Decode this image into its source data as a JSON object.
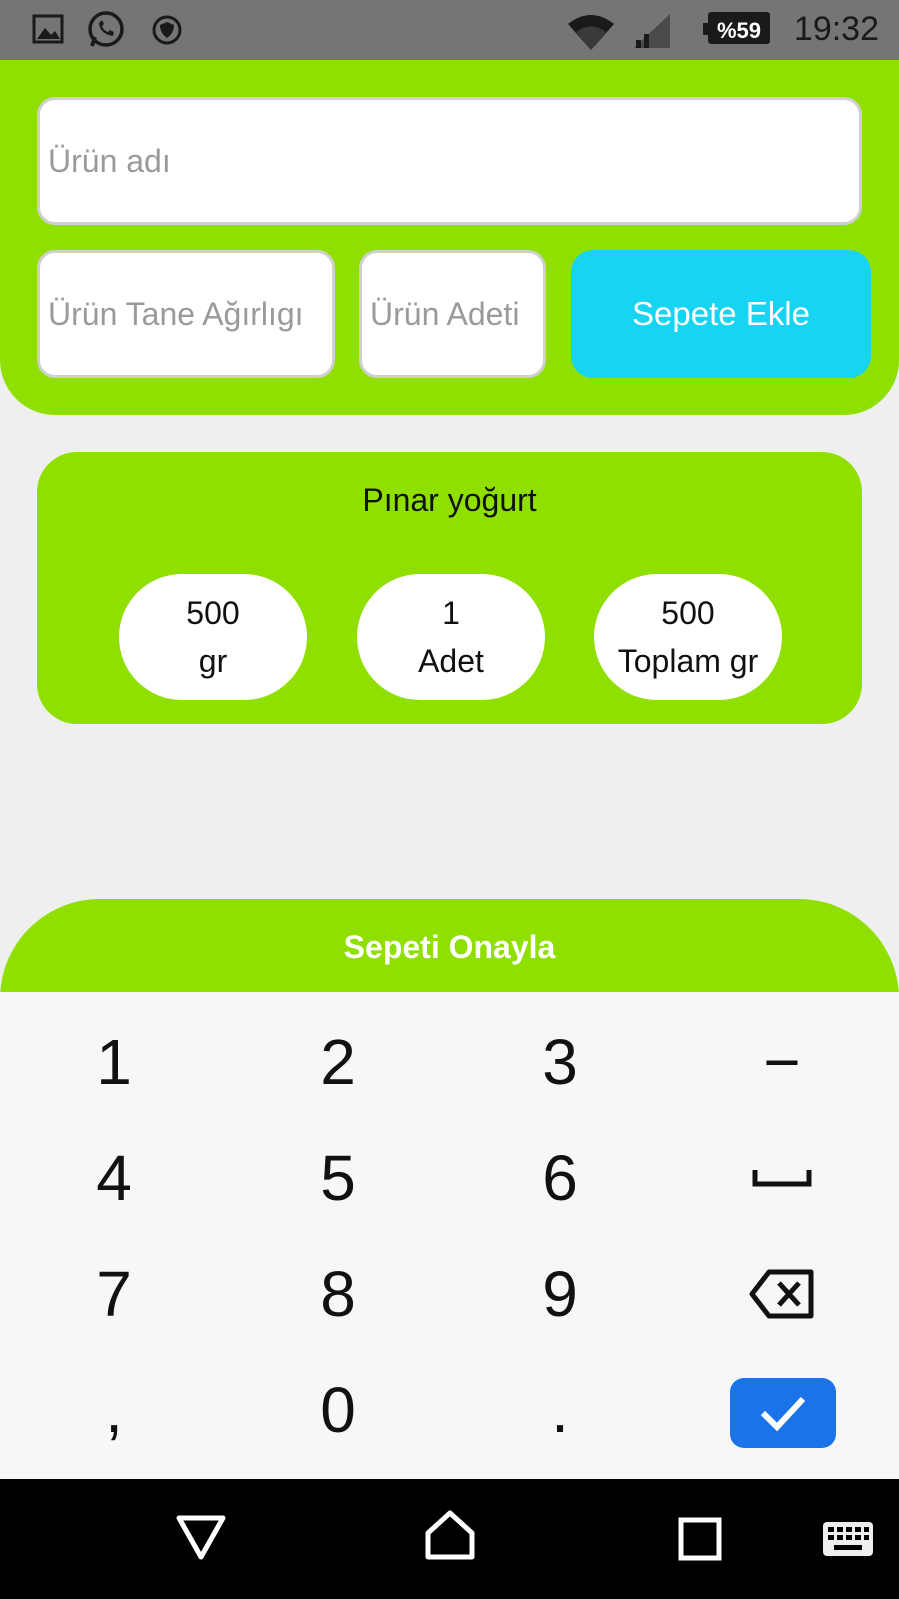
{
  "status_bar": {
    "time": "19:32",
    "battery": "%59",
    "icons": [
      "gallery-icon",
      "whatsapp-icon",
      "shield-icon",
      "wifi-icon",
      "signal-icon",
      "battery-icon"
    ]
  },
  "form": {
    "product_name_placeholder": "Ürün adı",
    "unit_weight_placeholder": "Ürün Tane Ağırlıgı",
    "quantity_placeholder": "Ürün Adeti",
    "add_to_cart_label": "Sepete Ekle"
  },
  "cart_item": {
    "name": "Pınar yoğurt",
    "weight_value": "500",
    "weight_unit": "gr",
    "quantity_value": "1",
    "quantity_unit": "Adet",
    "total_value": "500",
    "total_unit": "Toplam gr"
  },
  "confirm_label": "Sepeti Onayla",
  "keyboard": {
    "keys": [
      "1",
      "2",
      "3",
      "−",
      "4",
      "5",
      "6",
      "space",
      "7",
      "8",
      "9",
      "backspace",
      ",",
      "0",
      ".",
      "done"
    ]
  },
  "colors": {
    "panel_green": "#8fe000",
    "add_button": "#17d4f2",
    "done_key": "#1a73e8"
  }
}
